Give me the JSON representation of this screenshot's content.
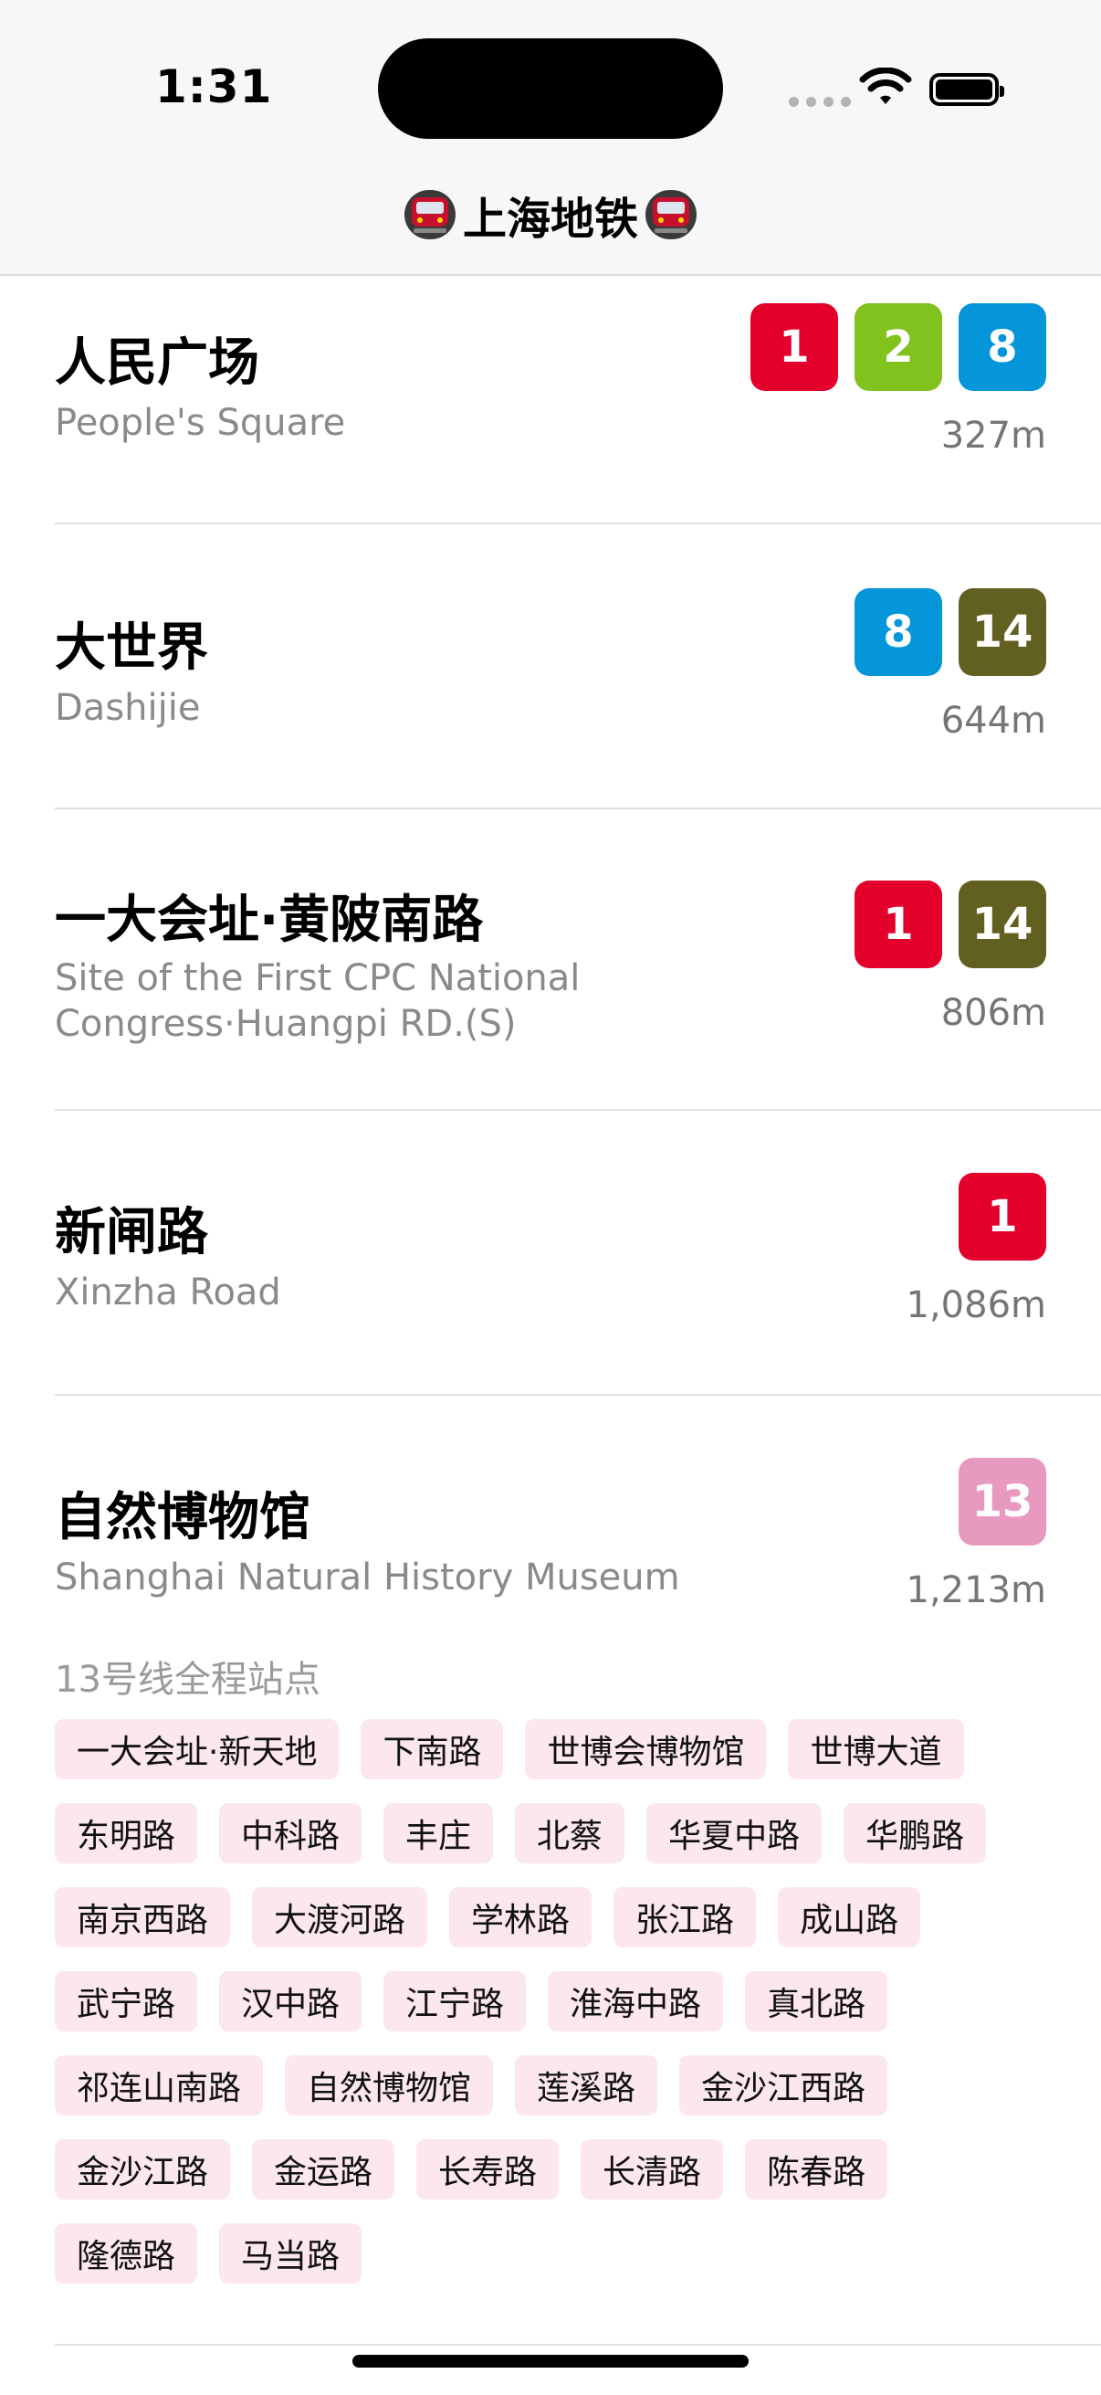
{
  "status_bar": {
    "time": "1:31"
  },
  "header": {
    "title": "上海地铁"
  },
  "colors": {
    "line_1": "#e3002b",
    "line_2": "#82c21e",
    "line_8": "#0595d9",
    "line_13": "#e899c0",
    "line_14": "#626020",
    "chip_bg": "#fbe7ec"
  },
  "stations": [
    {
      "name": "人民广场",
      "english": "People's Square",
      "distance": "327m",
      "lines": [
        {
          "label": "1",
          "color": "#e3002b"
        },
        {
          "label": "2",
          "color": "#82c21e"
        },
        {
          "label": "8",
          "color": "#0595d9"
        }
      ]
    },
    {
      "name": "大世界",
      "english": "Dashijie",
      "distance": "644m",
      "lines": [
        {
          "label": "8",
          "color": "#0595d9"
        },
        {
          "label": "14",
          "color": "#626020"
        }
      ]
    },
    {
      "name": "一大会址·黄陂南路",
      "english": "Site of the First CPC National Congress·Huangpi RD.(S)",
      "distance": "806m",
      "lines": [
        {
          "label": "1",
          "color": "#e3002b"
        },
        {
          "label": "14",
          "color": "#626020"
        }
      ]
    },
    {
      "name": "新闸路",
      "english": "Xinzha Road",
      "distance": "1,086m",
      "lines": [
        {
          "label": "1",
          "color": "#e3002b"
        }
      ]
    },
    {
      "name": "自然博物馆",
      "english": "Shanghai Natural History Museum",
      "distance": "1,213m",
      "lines": [
        {
          "label": "13",
          "color": "#e899c0"
        }
      ]
    }
  ],
  "expanded_line": {
    "label": "13号线全程站点",
    "stops": [
      "一大会址·新天地",
      "下南路",
      "世博会博物馆",
      "世博大道",
      "东明路",
      "中科路",
      "丰庄",
      "北蔡",
      "华夏中路",
      "华鹏路",
      "南京西路",
      "大渡河路",
      "学林路",
      "张江路",
      "成山路",
      "武宁路",
      "汉中路",
      "江宁路",
      "淮海中路",
      "真北路",
      "祁连山南路",
      "自然博物馆",
      "莲溪路",
      "金沙江西路",
      "金沙江路",
      "金运路",
      "长寿路",
      "长清路",
      "陈春路",
      "隆德路",
      "马当路"
    ]
  }
}
